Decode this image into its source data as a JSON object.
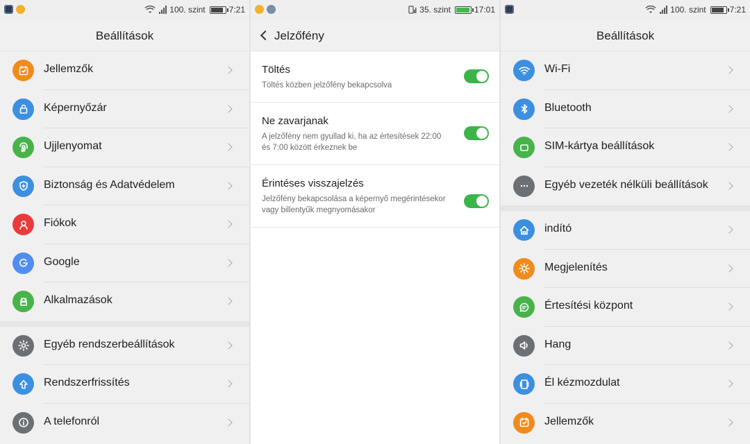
{
  "left_screen": {
    "status": {
      "signal_text": "100. szint",
      "time": "7:21"
    },
    "title": "Beállítások",
    "groups": [
      [
        {
          "label": "Jellemzők",
          "icon": "features-icon",
          "color": "#f08b1d"
        },
        {
          "label": "Képernyőzár",
          "icon": "lock-icon",
          "color": "#3d8fe0"
        },
        {
          "label": "Ujjlenyomat",
          "icon": "fingerprint-icon",
          "color": "#47b34a"
        },
        {
          "label": "Biztonság és Adatvédelem",
          "icon": "shield-icon",
          "color": "#3d8fe0"
        },
        {
          "label": "Fiókok",
          "icon": "account-icon",
          "color": "#ea3b3b"
        },
        {
          "label": "Google",
          "icon": "google-icon",
          "color": "#4f8ef0"
        },
        {
          "label": "Alkalmazások",
          "icon": "android-icon",
          "color": "#47b34a"
        }
      ],
      [
        {
          "label": "Egyéb rendszerbeállítások",
          "icon": "gear-icon",
          "color": "#6c6f74"
        },
        {
          "label": "Rendszerfrissítés",
          "icon": "update-arrow-icon",
          "color": "#3d8fe0"
        },
        {
          "label": "A telefonról",
          "icon": "info-icon",
          "color": "#6c6f74"
        }
      ]
    ]
  },
  "middle_screen": {
    "status": {
      "signal_text": "35. szint",
      "time": "17:01"
    },
    "title": "Jelzőfény",
    "toggles": [
      {
        "title": "Töltés",
        "desc": "Töltés közben jelzőfény bekapcsolva",
        "on": true
      },
      {
        "title": "Ne zavarjanak",
        "desc": "A jelzőfény nem gyullad ki, ha az értesítések 22:00 és 7:00 között érkeznek be",
        "on": true
      },
      {
        "title": "Érintéses visszajelzés",
        "desc": "Jelzőfény bekapcsolása a képernyő megérintésekor vagy billentyűk megnyomásakor",
        "on": true
      }
    ]
  },
  "right_screen": {
    "status": {
      "signal_text": "100. szint",
      "time": "7:21"
    },
    "title": "Beállítások",
    "groups": [
      [
        {
          "label": "Wi-Fi",
          "icon": "wifi-icon",
          "color": "#3d8fe0"
        },
        {
          "label": "Bluetooth",
          "icon": "bluetooth-icon",
          "color": "#3d8fe0"
        },
        {
          "label": "SIM-kártya beállítások",
          "icon": "sim-card-icon",
          "color": "#47b34a"
        },
        {
          "label": "Egyéb vezeték nélküli beállítások",
          "icon": "more-icon",
          "color": "#6c6f74"
        }
      ],
      [
        {
          "label": "indító",
          "icon": "home-icon",
          "color": "#3d8fe0"
        },
        {
          "label": "Megjelenítés",
          "icon": "brightness-icon",
          "color": "#f08b1d"
        },
        {
          "label": "Értesítési központ",
          "icon": "chat-bubble-icon",
          "color": "#47b34a"
        },
        {
          "label": "Hang",
          "icon": "speaker-icon",
          "color": "#6c6f74"
        },
        {
          "label": "Él kézmozdulat",
          "icon": "edge-gesture-icon",
          "color": "#3d8fe0"
        },
        {
          "label": "Jellemzők",
          "icon": "features-icon",
          "color": "#f08b1d"
        }
      ]
    ]
  }
}
